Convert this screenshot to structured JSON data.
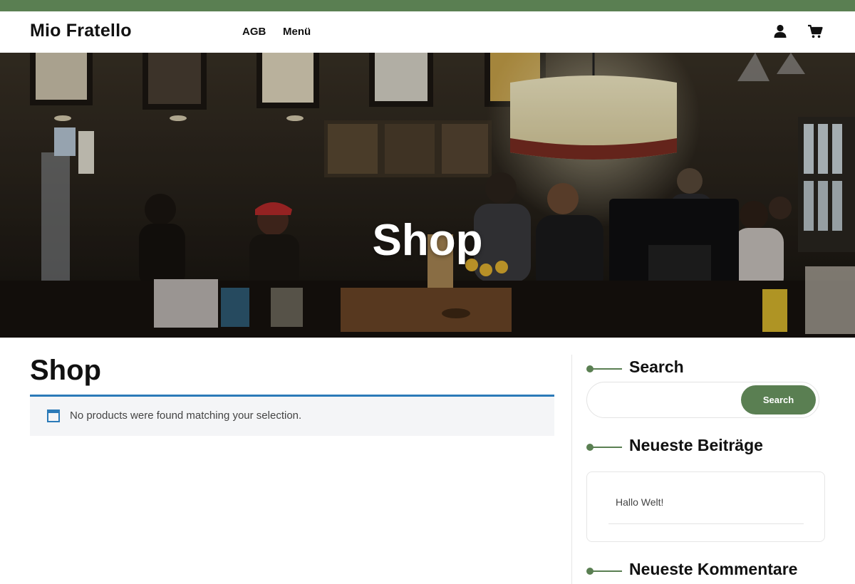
{
  "header": {
    "site_title": "Mio Fratello",
    "nav": [
      {
        "label": "AGB"
      },
      {
        "label": "Menü"
      }
    ],
    "icons": [
      "user-icon",
      "cart-icon"
    ]
  },
  "hero": {
    "title": "Shop"
  },
  "main": {
    "page_title": "Shop",
    "notice": {
      "icon": "info-window-icon",
      "text": "No products were found matching your selection."
    }
  },
  "sidebar": {
    "search": {
      "heading": "Search",
      "input_value": "",
      "input_placeholder": "",
      "button_label": "Search"
    },
    "recent_posts": {
      "heading": "Neueste Beiträge",
      "items": [
        {
          "title": "Hallo Welt!"
        }
      ]
    },
    "recent_comments": {
      "heading": "Neueste Kommentare"
    }
  },
  "colors": {
    "brand_green": "#5a7f52",
    "notice_border": "#2b7ab8",
    "notice_bg": "#f4f5f7"
  }
}
